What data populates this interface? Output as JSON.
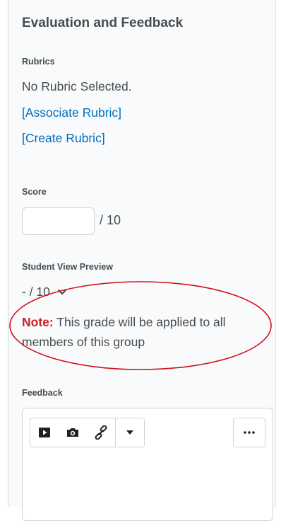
{
  "panel": {
    "title": "Evaluation and Feedback",
    "rubrics": {
      "label": "Rubrics",
      "status": "No Rubric Selected.",
      "associate_link": "[Associate Rubric]",
      "create_link": "[Create Rubric]"
    },
    "score": {
      "label": "Score",
      "value": "",
      "out_of": "/ 10"
    },
    "student_view": {
      "label": "Student View Preview",
      "value": "- / 10"
    },
    "note": {
      "label": "Note:",
      "text": " This grade will be applied to all members of this group"
    },
    "feedback": {
      "label": "Feedback",
      "toolbar": {
        "icons": [
          "video-icon",
          "camera-icon",
          "link-icon",
          "dropdown-caret-icon"
        ],
        "more_icon": "ellipsis-icon"
      }
    }
  },
  "colors": {
    "link": "#006fbf",
    "note_label": "#cd2026",
    "annotation_ellipse": "#d0101a",
    "panel_bg": "#f9fafb"
  }
}
